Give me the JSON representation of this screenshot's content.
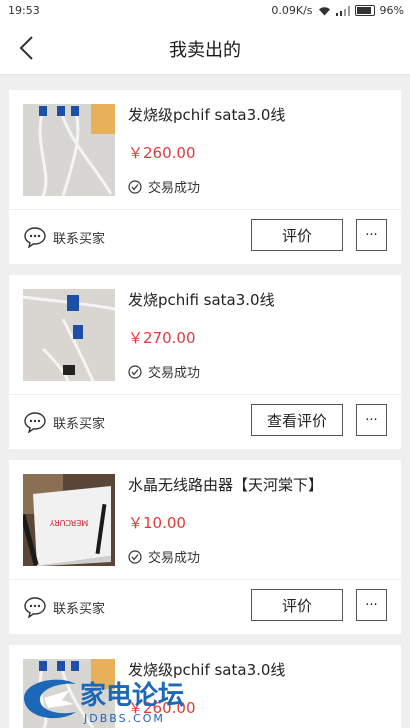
{
  "status_bar": {
    "time": "19:53",
    "speed": "0.09K/s",
    "battery": "96%"
  },
  "header": {
    "title": "我卖出的"
  },
  "orders": [
    {
      "title": "发烧级pchif sata3.0线",
      "price": "￥260.00",
      "status": "交易成功",
      "contact": "联系买家",
      "action": "评价",
      "more": "···"
    },
    {
      "title": "发烧pchifi sata3.0线",
      "price": "￥270.00",
      "status": "交易成功",
      "contact": "联系买家",
      "action": "查看评价",
      "more": "···"
    },
    {
      "title": "水晶无线路由器【天河棠下】",
      "price": "￥10.00",
      "status": "交易成功",
      "contact": "联系买家",
      "action": "评价",
      "more": "···",
      "thumb_label": "MERCURY"
    },
    {
      "title": "发烧级pchif sata3.0线",
      "price": "￥260.00"
    }
  ],
  "watermark": {
    "brand": "家电论坛",
    "domain": "JDBBS.COM"
  },
  "colors": {
    "price": "#e03b3b",
    "background": "#efefef",
    "watermark": "#1c67b8"
  }
}
